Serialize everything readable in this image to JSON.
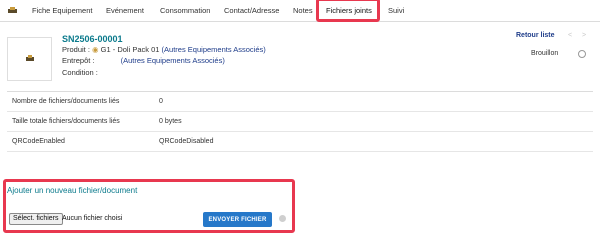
{
  "tabs": [
    {
      "label": "Fiche Equipement"
    },
    {
      "label": "Evénement"
    },
    {
      "label": "Consommation"
    },
    {
      "label": "Contact/Adresse"
    },
    {
      "label": "Notes"
    },
    {
      "label": "Fichiers joints",
      "active": true
    },
    {
      "label": "Suivi"
    }
  ],
  "header": {
    "ref": "SN2506-00001",
    "product_label": "Produit :",
    "product_name": "G1 - Doli Pack 01",
    "product_link": "(Autres Equipements Associés)",
    "warehouse_label": "Entrepôt :",
    "warehouse_link": "(Autres Equipements Associés)",
    "condition_label": "Condition :",
    "retour": "Retour liste",
    "prev": "<",
    "next": ">",
    "status": "Brouillon"
  },
  "info": [
    {
      "key": "Nombre de fichiers/documents liés",
      "value": "0"
    },
    {
      "key": "Taille totale fichiers/documents liés",
      "value": "0 bytes"
    },
    {
      "key": "QRCodeEnabled",
      "value": "QRCodeDisabled"
    }
  ],
  "upload": {
    "title": "Ajouter un nouveau fichier/document",
    "choose_label": "Sélect. fichiers",
    "no_file_text": "Aucun fichier choisi",
    "send_label": "ENVOYER FICHIER"
  },
  "colors": {
    "accent": "#0b7a8c",
    "highlight": "#e8384f",
    "button": "#2678c9",
    "link": "#1f3d8a"
  }
}
